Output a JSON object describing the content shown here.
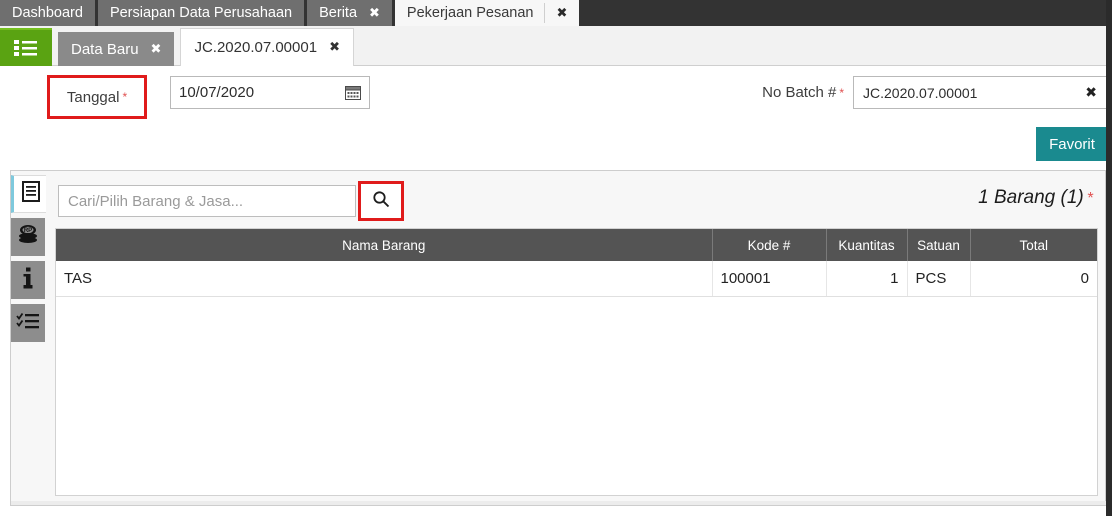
{
  "topbar": {
    "tabs": [
      {
        "label": "Dashboard",
        "closable": false,
        "active": false
      },
      {
        "label": "Persiapan Data Perusahaan",
        "closable": false,
        "active": false
      },
      {
        "label": "Berita",
        "closable": true,
        "active": false
      },
      {
        "label": "Pekerjaan Pesanan",
        "closable": true,
        "active": true
      }
    ],
    "close_glyph": "✖"
  },
  "subbar": {
    "menu_icon": "list-menu-icon",
    "tabs": [
      {
        "label": "Data Baru",
        "closable": true,
        "active": false
      },
      {
        "label": "JC.2020.07.00001",
        "closable": true,
        "active": true
      }
    ],
    "close_glyph": "✖"
  },
  "form": {
    "tanggal_label": "Tanggal",
    "tanggal_required": "*",
    "tanggal_value": "10/07/2020",
    "calendar_icon": "calendar-icon",
    "batch_label": "No Batch #",
    "batch_required": "*",
    "batch_value": "JC.2020.07.00001",
    "batch_clear_glyph": "✖",
    "favorit_label": "Favorit"
  },
  "sidebar": {
    "items": [
      {
        "icon": "document-lines-icon",
        "active": true
      },
      {
        "icon": "rp-coins-icon",
        "active": false
      },
      {
        "icon": "info-icon",
        "active": false
      },
      {
        "icon": "checklist-icon",
        "active": false
      }
    ]
  },
  "search": {
    "placeholder": "Cari/Pilih Barang & Jasa...",
    "value": "",
    "button_icon": "search-icon"
  },
  "item_count_label": "1 Barang (1)",
  "item_count_required": "*",
  "table": {
    "columns": [
      {
        "label": "Nama Barang",
        "align": "center"
      },
      {
        "label": "Kode #",
        "align": "center"
      },
      {
        "label": "Kuantitas",
        "align": "center"
      },
      {
        "label": "Satuan",
        "align": "center"
      },
      {
        "label": "Total",
        "align": "center"
      }
    ],
    "rows": [
      {
        "nama_barang": "TAS",
        "kode": "100001",
        "kuantitas": "1",
        "satuan": "PCS",
        "total": "0"
      }
    ]
  },
  "colors": {
    "topbar_bg": "#333333",
    "tab_inactive": "#6f6f6f",
    "tab_active": "#f7f7f7",
    "green_button": "#5aa312",
    "favorit_teal": "#1a8a8f",
    "highlight_red": "#e01b1b",
    "table_header": "#545454",
    "required_red": "#e05050",
    "active_side_accent": "#7ec9dd"
  }
}
